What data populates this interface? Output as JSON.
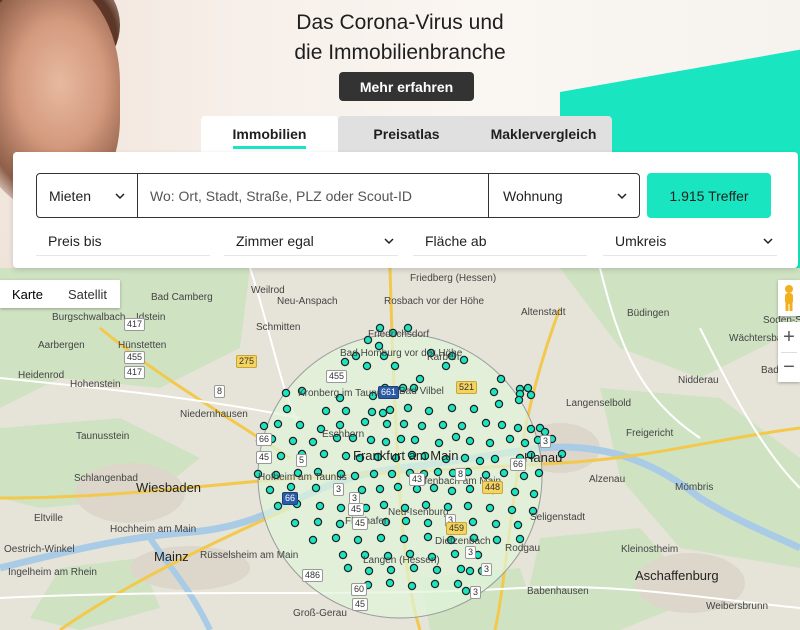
{
  "hero": {
    "title_line1": "Das Corona-Virus und",
    "title_line2": "die Immobilienbranche",
    "cta_label": "Mehr erfahren"
  },
  "tabs": [
    {
      "label": "Immobilien",
      "active": true
    },
    {
      "label": "Preisatlas",
      "active": false
    },
    {
      "label": "Maklervergleich",
      "active": false
    }
  ],
  "search": {
    "offer_type": "Mieten",
    "where_placeholder": "Wo: Ort, Stadt, Straße, PLZ oder Scout-ID",
    "where_value": "",
    "property_type": "Wohnung",
    "results_label": "1.915 Treffer"
  },
  "filters": {
    "price": "Preis bis",
    "rooms": "Zimmer egal",
    "area": "Fläche ab",
    "radius": "Umkreis"
  },
  "map": {
    "type_map": "Karte",
    "type_satellite": "Satellit",
    "zoom_in": "+",
    "zoom_out": "−",
    "marker_color": "#19e6c1",
    "places": [
      {
        "name": "Friedberg (Hessen)",
        "kind": "town"
      },
      {
        "name": "Bad Camberg",
        "kind": "town"
      },
      {
        "name": "Weilrod",
        "kind": "town"
      },
      {
        "name": "Neu-Anspach",
        "kind": "town"
      },
      {
        "name": "Rosbach vor der Höhe",
        "kind": "town"
      },
      {
        "name": "Altenstadt",
        "kind": "town"
      },
      {
        "name": "Büdingen",
        "kind": "town"
      },
      {
        "name": "Burgschwalbach",
        "kind": "town"
      },
      {
        "name": "Idstein",
        "kind": "town"
      },
      {
        "name": "Schmitten",
        "kind": "town"
      },
      {
        "name": "Friedrichsdorf",
        "kind": "town"
      },
      {
        "name": "Soden-Salm",
        "kind": "town"
      },
      {
        "name": "Aarbergen",
        "kind": "town"
      },
      {
        "name": "Hünstetten",
        "kind": "town"
      },
      {
        "name": "Bad Homburg vor der Höhe",
        "kind": "town"
      },
      {
        "name": "Karben",
        "kind": "town"
      },
      {
        "name": "Wächtersbach",
        "kind": "town"
      },
      {
        "name": "Heidenrod",
        "kind": "town"
      },
      {
        "name": "Hohenstein",
        "kind": "town"
      },
      {
        "name": "Bad Vilbel",
        "kind": "town"
      },
      {
        "name": "Nidderau",
        "kind": "town"
      },
      {
        "name": "Bad Orb",
        "kind": "town"
      },
      {
        "name": "Kronberg im Taunus",
        "kind": "town"
      },
      {
        "name": "Niedernhausen",
        "kind": "town"
      },
      {
        "name": "Langenselbold",
        "kind": "town"
      },
      {
        "name": "Taunusstein",
        "kind": "town"
      },
      {
        "name": "Eschborn",
        "kind": "town"
      },
      {
        "name": "Freigericht",
        "kind": "town"
      },
      {
        "name": "Frankfurt am Main",
        "kind": "city"
      },
      {
        "name": "Hanau",
        "kind": "city"
      },
      {
        "name": "Schlangenbad",
        "kind": "town"
      },
      {
        "name": "Hofheim am Taunus",
        "kind": "town"
      },
      {
        "name": "Alzenau",
        "kind": "town"
      },
      {
        "name": "Wiesbaden",
        "kind": "city"
      },
      {
        "name": "Offenbach am Main",
        "kind": "town"
      },
      {
        "name": "Mömbris",
        "kind": "town"
      },
      {
        "name": "Eltville",
        "kind": "town"
      },
      {
        "name": "Flughafen",
        "kind": "poi"
      },
      {
        "name": "Seligenstadt",
        "kind": "town"
      },
      {
        "name": "Neu-Isenburg",
        "kind": "town"
      },
      {
        "name": "Oestrich-Winkel",
        "kind": "town"
      },
      {
        "name": "Hochheim am Main",
        "kind": "town"
      },
      {
        "name": "Kleinostheim",
        "kind": "town"
      },
      {
        "name": "Mainz",
        "kind": "city"
      },
      {
        "name": "Rüsselsheim am Main",
        "kind": "town"
      },
      {
        "name": "Dietzenbach",
        "kind": "town"
      },
      {
        "name": "Rodgau",
        "kind": "town"
      },
      {
        "name": "Ingelheim am Rhein",
        "kind": "town"
      },
      {
        "name": "Aschaffenburg",
        "kind": "city"
      },
      {
        "name": "Langen (Hessen)",
        "kind": "town"
      },
      {
        "name": "Babenhausen",
        "kind": "town"
      },
      {
        "name": "Groß-Gerau",
        "kind": "town"
      },
      {
        "name": "Weibersbrunn",
        "kind": "town"
      }
    ],
    "road_shields": [
      "417",
      "455",
      "417",
      "275",
      "8",
      "455",
      "661",
      "521",
      "66",
      "3",
      "45",
      "5",
      "66",
      "3",
      "43",
      "8",
      "66",
      "3",
      "45",
      "448",
      "45",
      "3",
      "459",
      "3",
      "3",
      "60",
      "486",
      "45",
      "3"
    ]
  }
}
